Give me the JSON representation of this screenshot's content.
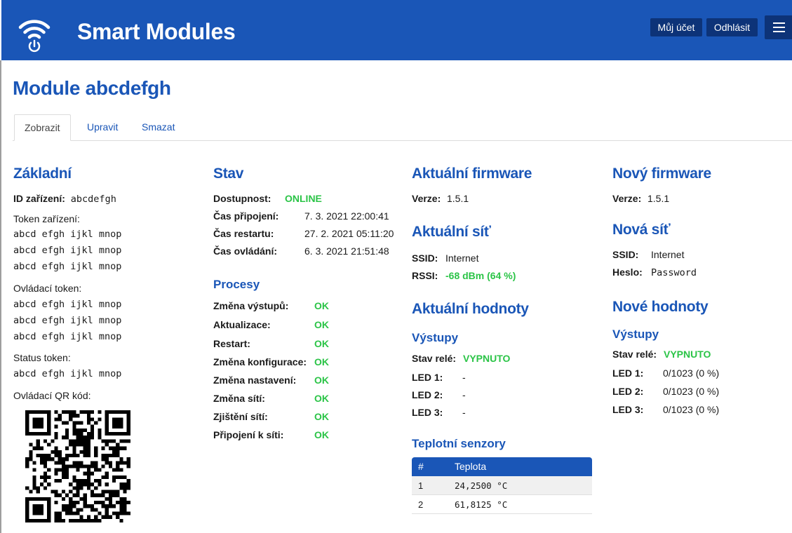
{
  "header": {
    "brand": "Smart Modules",
    "account_label": "Můj účet",
    "logout_label": "Odhlásit"
  },
  "page": {
    "title": "Module abcdefgh",
    "tabs": [
      "Zobrazit",
      "Upravit",
      "Smazat"
    ]
  },
  "basic": {
    "heading": "Základní",
    "device_id_label": "ID zařízení:",
    "device_id": "abcdefgh",
    "device_token_label": "Token zařízení:",
    "device_token_lines": [
      "abcd efgh ijkl mnop",
      "abcd efgh ijkl mnop",
      "abcd efgh ijkl mnop"
    ],
    "control_token_label": "Ovládací token:",
    "control_token_lines": [
      "abcd efgh ijkl mnop",
      "abcd efgh ijkl mnop",
      "abcd efgh ijkl mnop"
    ],
    "status_token_label": "Status token:",
    "status_token_lines": [
      "abcd efgh ijkl mnop"
    ],
    "qr_label": "Ovládací QR kód:"
  },
  "status": {
    "heading": "Stav",
    "availability_label": "Dostupnost:",
    "availability": "ONLINE",
    "connect_time_label": "Čas připojení:",
    "connect_time": "7. 3. 2021 22:00:41",
    "restart_time_label": "Čas restartu:",
    "restart_time": "27. 2. 2021 05:11:20",
    "control_time_label": "Čas ovládání:",
    "control_time": "6. 3. 2021 21:51:48",
    "processes_heading": "Procesy",
    "processes": [
      {
        "label": "Změna výstupů:",
        "value": "OK"
      },
      {
        "label": "Aktualizace:",
        "value": "OK"
      },
      {
        "label": "Restart:",
        "value": "OK"
      },
      {
        "label": "Změna konfigurace:",
        "value": "OK"
      },
      {
        "label": "Změna nastavení:",
        "value": "OK"
      },
      {
        "label": "Změna sítí:",
        "value": "OK"
      },
      {
        "label": "Zjištění sítí:",
        "value": "OK"
      },
      {
        "label": "Připojení k síti:",
        "value": "OK"
      }
    ]
  },
  "current": {
    "firmware_heading": "Aktuální firmware",
    "version_label": "Verze:",
    "version": "1.5.1",
    "network_heading": "Aktuální síť",
    "ssid_label": "SSID:",
    "ssid": "Internet",
    "rssi_label": "RSSI:",
    "rssi": "-68 dBm (64 %)",
    "values_heading": "Aktuální hodnoty",
    "outputs_heading": "Výstupy",
    "relay_label": "Stav relé:",
    "relay": "VYPNUTO",
    "leds": [
      {
        "label": "LED 1:",
        "value": "-"
      },
      {
        "label": "LED 2:",
        "value": "-"
      },
      {
        "label": "LED 3:",
        "value": "-"
      }
    ],
    "sensors_heading": "Teplotní senzory",
    "sensors_table": {
      "headers": [
        "#",
        "Teplota"
      ],
      "rows": [
        [
          "1",
          "24,2500 °C"
        ],
        [
          "2",
          "61,8125 °C"
        ]
      ]
    }
  },
  "new": {
    "firmware_heading": "Nový firmware",
    "version_label": "Verze:",
    "version": "1.5.1",
    "network_heading": "Nová síť",
    "ssid_label": "SSID:",
    "ssid": "Internet",
    "password_label": "Heslo:",
    "password": "Password",
    "values_heading": "Nové hodnoty",
    "outputs_heading": "Výstupy",
    "relay_label": "Stav relé:",
    "relay": "VYPNUTO",
    "leds": [
      {
        "label": "LED 1:",
        "value": "0/1023 (0 %)"
      },
      {
        "label": "LED 2:",
        "value": "0/1023 (0 %)"
      },
      {
        "label": "LED 3:",
        "value": "0/1023 (0 %)"
      }
    ]
  },
  "colors": {
    "brand": "#1a56b7",
    "button_dark": "#0d3378",
    "ok_green": "#2bc447"
  },
  "icons": {
    "logo": "wifi-power-icon",
    "menu": "hamburger-icon"
  }
}
